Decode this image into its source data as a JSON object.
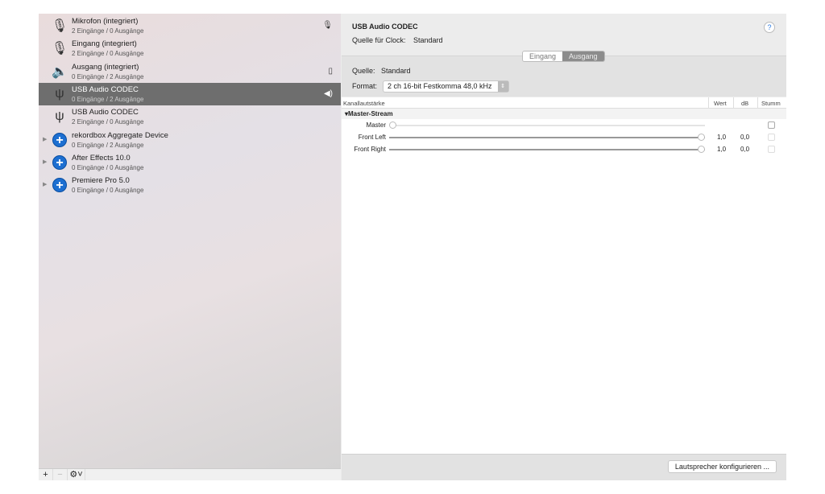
{
  "devices": [
    {
      "name": "Mikrofon (integriert)",
      "io": "2 Eingänge / 0 Ausgänge",
      "icon": "microphone-icon",
      "status_icon": "microphone-icon"
    },
    {
      "name": "Eingang (integriert)",
      "io": "2 Eingänge / 0 Ausgänge",
      "icon": "microphone-icon"
    },
    {
      "name": "Ausgang (integriert)",
      "io": "0 Eingänge / 2 Ausgänge",
      "icon": "speaker-icon",
      "status_icon": "finder-icon"
    },
    {
      "name": "USB Audio CODEC",
      "io": "0 Eingänge / 2 Ausgänge",
      "icon": "usb-icon",
      "status_icon": "speaker-volume-icon",
      "selected": true
    },
    {
      "name": "USB Audio CODEC",
      "io": "2 Eingänge / 0 Ausgänge",
      "icon": "usb-icon"
    },
    {
      "name": "rekordbox Aggregate Device",
      "io": "0 Eingänge / 2 Ausgänge",
      "icon": "aggregate-icon",
      "expandable": true
    },
    {
      "name": "After Effects 10.0",
      "io": "0 Eingänge / 0 Ausgänge",
      "icon": "aggregate-icon",
      "expandable": true
    },
    {
      "name": "Premiere Pro 5.0",
      "io": "0 Eingänge / 0 Ausgänge",
      "icon": "aggregate-icon",
      "expandable": true
    }
  ],
  "sidebar_footer": {
    "add": "+",
    "remove": "−",
    "gear": "⚙˅"
  },
  "detail": {
    "title": "USB Audio CODEC",
    "clock_label": "Quelle für Clock:",
    "clock_value": "Standard",
    "help": "?",
    "tabs": [
      {
        "label": "Eingang",
        "active": false
      },
      {
        "label": "Ausgang",
        "active": true
      }
    ],
    "source_label": "Quelle:",
    "source_value": "Standard",
    "format_label": "Format:",
    "format_value": "2 ch 16-bit Festkomma 48,0 kHz",
    "table": {
      "headers": {
        "channel": "Kanallautstärke",
        "value": "Wert",
        "db": "dB",
        "mute": "Stumm"
      },
      "group": "Master-Stream",
      "rows": [
        {
          "label": "Master",
          "value": "",
          "db": "",
          "level": 0,
          "enabled": false
        },
        {
          "label": "Front Left",
          "value": "1,0",
          "db": "0,0",
          "level": 1,
          "enabled": true
        },
        {
          "label": "Front Right",
          "value": "1,0",
          "db": "0,0",
          "level": 1,
          "enabled": true
        }
      ]
    },
    "configure_button": "Lautsprecher konfigurieren ..."
  }
}
